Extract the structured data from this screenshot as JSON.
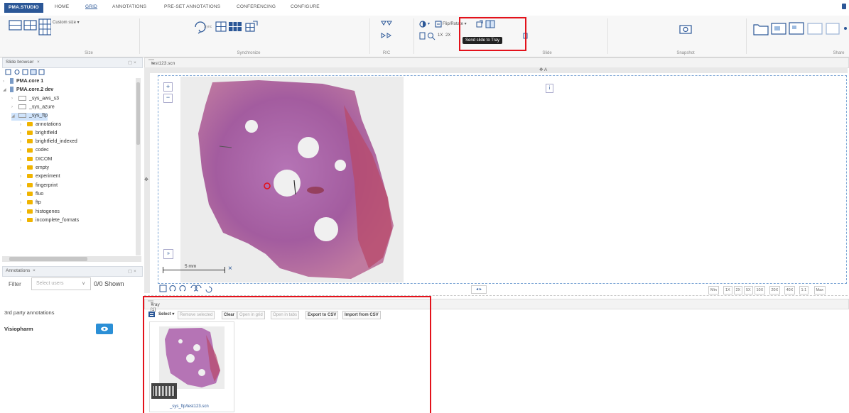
{
  "tabs": {
    "brand": "PMA.STUDIO",
    "home": "HOME",
    "grid": "GRID",
    "annotations": "ANNOTATIONS",
    "preset": "PRE-SET ANNOTATIONS",
    "conferencing": "CONFERENCING",
    "configure": "CONFIGURE"
  },
  "ribbon": {
    "custom_size": "Custom size ▾",
    "size_label": "Size",
    "sync_label": "Synchronize",
    "rc_label": "R/C",
    "slide_label": "Slide",
    "flip_rotate": "Flip/Rotate ▾",
    "zoom_1x": "1X",
    "zoom_2x": "2X",
    "tooltip": "Send slide to Tray",
    "snapshot_label": "Snapshot",
    "share_label": "Share"
  },
  "slide_browser": {
    "title": "Slide browser",
    "items": [
      {
        "label": "PMA.core 1",
        "bold": true
      },
      {
        "label": "PMA.core.2 dev",
        "bold": true
      },
      {
        "label": "_sys_aws_s3"
      },
      {
        "label": "_sys_azure"
      },
      {
        "label": "_sys_ftp"
      },
      {
        "label": "annotations"
      },
      {
        "label": "brightfield"
      },
      {
        "label": "brightfield_indexed"
      },
      {
        "label": "codec"
      },
      {
        "label": "DICOM"
      },
      {
        "label": "empty"
      },
      {
        "label": "experiment"
      },
      {
        "label": "fingerprint"
      },
      {
        "label": "fluo"
      },
      {
        "label": "ftp"
      },
      {
        "label": "histogenes"
      },
      {
        "label": "incomplete_formats"
      }
    ]
  },
  "annotations_panel": {
    "title": "Annotations",
    "filter_label": "Filter",
    "select_placeholder": "Select users",
    "shown": "0/0 Shown",
    "third_party": "3rd party annotations",
    "visiopharm": "Visiopharm"
  },
  "viewer": {
    "tab_title": "test123.scn",
    "scale_label": "5 mm",
    "zoom_buttons": [
      "Min",
      "1X",
      "2X",
      "5X",
      "10X",
      "20X",
      "40X",
      "1:1",
      "Max"
    ],
    "top_marker": "A"
  },
  "tray": {
    "title": "Tray [1]",
    "select": "Select ▾",
    "remove_selected": "Remove selected",
    "clear": "Clear",
    "open_in_grid": "Open in grid",
    "open_in_tabs": "Open in tabs",
    "export_csv": "Export to CSV",
    "import_csv": "Import from CSV",
    "item_caption": "_sys_ftp/test123.scn"
  },
  "colors": {
    "brand": "#2b5797",
    "highlight": "#e3121b",
    "folder": "#f0b400"
  }
}
